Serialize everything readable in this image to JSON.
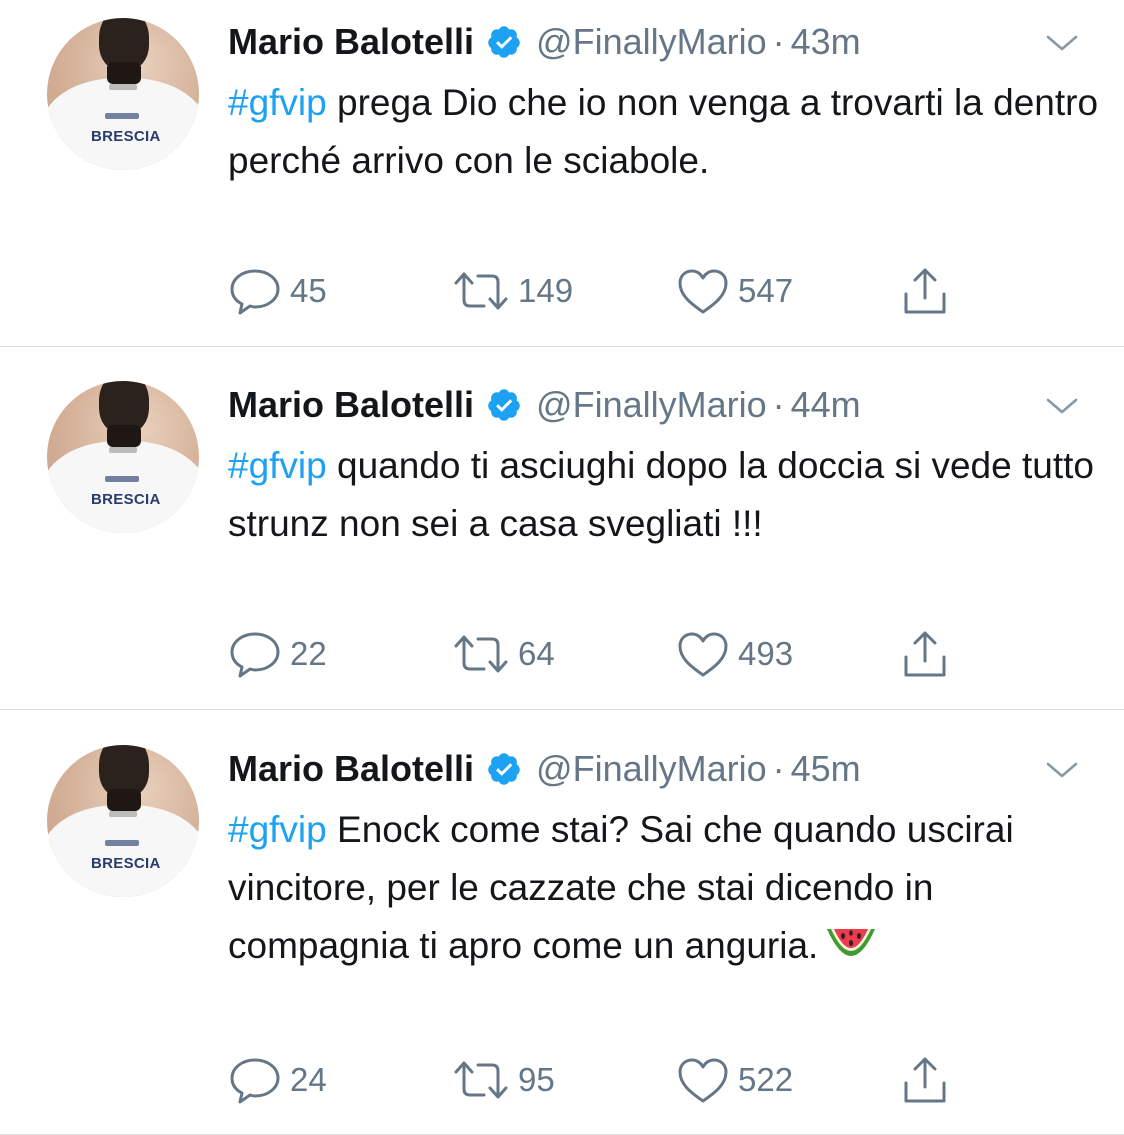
{
  "tweets": [
    {
      "name": "Mario Balotelli",
      "handle": "@FinallyMario",
      "separator": "·",
      "time": "43m",
      "hashtag": "#gfvip",
      "text": " prega Dio che io non venga a trovarti la dentro perché arrivo con le sciabole.",
      "replies": "45",
      "retweets": "149",
      "likes": "547",
      "avatar_text": "BRESCIA"
    },
    {
      "name": "Mario Balotelli",
      "handle": "@FinallyMario",
      "separator": "·",
      "time": "44m",
      "hashtag": "#gfvip",
      "text": " quando ti asciughi dopo la doccia si vede tutto strunz non sei a casa svegliati !!!",
      "replies": "22",
      "retweets": "64",
      "likes": "493",
      "avatar_text": "BRESCIA"
    },
    {
      "name": "Mario Balotelli",
      "handle": "@FinallyMario",
      "separator": "·",
      "time": "45m",
      "hashtag": "#gfvip",
      "text": " Enock come stai? Sai che quando uscirai vincitore, per le cazzate che stai dicendo in compagnia ti apro come un anguria.",
      "replies": "24",
      "retweets": "95",
      "likes": "522",
      "avatar_text": "BRESCIA"
    }
  ],
  "colors": {
    "link": "#1da1f2",
    "secondary_text": "#657786",
    "primary_text": "#14171a",
    "verified_badge": "#1da1f2",
    "divider": "#d9dde0"
  },
  "icons": [
    "reply-icon",
    "retweet-icon",
    "like-icon",
    "share-icon",
    "verified-badge-icon",
    "chevron-down-icon",
    "watermelon-emoji"
  ]
}
